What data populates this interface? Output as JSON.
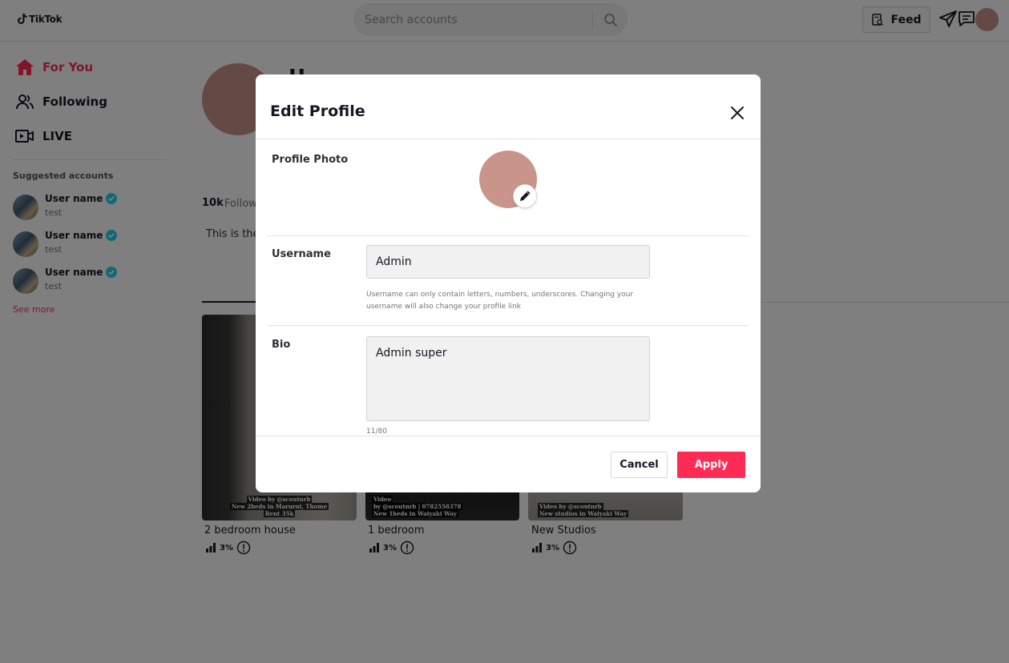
{
  "topbar": {
    "logo_text": "TikTok",
    "search_placeholder": "Search accounts",
    "feed_label": "Feed"
  },
  "sidebar": {
    "nav": [
      {
        "label": "For You",
        "icon": "home-icon",
        "active": true
      },
      {
        "label": "Following",
        "icon": "people-icon",
        "active": false
      },
      {
        "label": "LIVE",
        "icon": "live-icon",
        "active": false
      }
    ],
    "suggested_title": "Suggested accounts",
    "accounts": [
      {
        "name": "User name",
        "sub": "test",
        "verified": true
      },
      {
        "name": "User name",
        "sub": "test",
        "verified": true
      },
      {
        "name": "User name",
        "sub": "test",
        "verified": true
      }
    ],
    "see_more": "See more"
  },
  "profile": {
    "name_partial": "U",
    "followers_count": "10k",
    "followers_label": "Follow",
    "bio_partial": "This is the"
  },
  "videos": [
    {
      "title": "2 bedroom house",
      "stat": "3%",
      "caption_lines": [
        "Video by @scoutnrb",
        "New 2beds in Marurui, Thome",
        "Rent 35k"
      ]
    },
    {
      "title": "1 bedroom",
      "stat": "3%",
      "caption_lines": [
        "Video",
        "by @scoutnrb | 0782558378",
        "New 1beds in Waiyaki Way"
      ]
    },
    {
      "title": "New Studios",
      "stat": "3%",
      "caption_lines": [
        "Video by @scoutnrb",
        "New studios in Waiyaki Way"
      ]
    }
  ],
  "modal": {
    "title": "Edit Profile",
    "photo_label": "Profile Photo",
    "username_label": "Username",
    "username_value": "Admin",
    "username_help": "Username can only contain letters, numbers, underscores. Changing your username will also change your profile link",
    "bio_label": "Bio",
    "bio_value": "Admin super",
    "bio_counter": "11/80",
    "cancel_label": "Cancel",
    "apply_label": "Apply"
  },
  "colors": {
    "accent": "#fe2c55",
    "avatar": "#c9958a",
    "verified": "#20d5ec"
  }
}
